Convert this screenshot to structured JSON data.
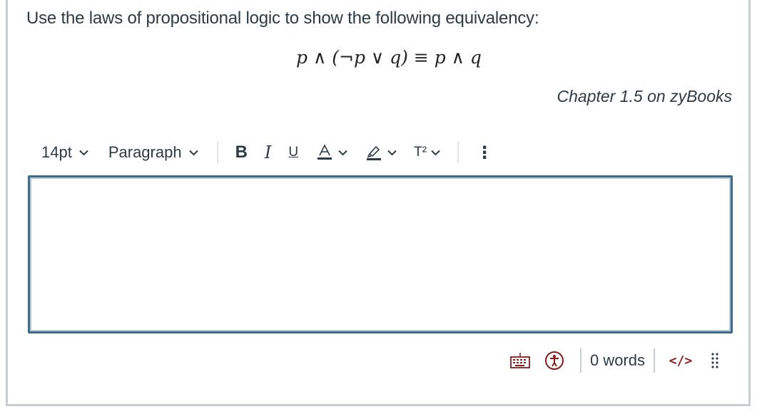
{
  "question": {
    "prompt": "Use the laws of propositional logic to show the following equivalency:",
    "formula": "p ∧ (¬p ∨ q) ≡ p ∧ q",
    "source": "Chapter 1.5 on zyBooks"
  },
  "toolbar": {
    "font_size": "14pt",
    "block_format": "Paragraph",
    "bold_label": "B",
    "italic_label": "I",
    "underline_label": "U",
    "text_color_label": "A",
    "superscript_label": "T²",
    "more_label": "⋮",
    "icons": [
      "chevron-down-icon",
      "text-color-icon",
      "highlight-icon",
      "superscript-icon",
      "more-vertical-icon"
    ]
  },
  "editor": {
    "content": ""
  },
  "statusbar": {
    "icons": [
      "keyboard-icon",
      "accessibility-icon",
      "html-code-icon",
      "drag-handle-icon"
    ],
    "word_count": "0 words",
    "html_label": "</>"
  },
  "colors": {
    "text": "#2d3b45",
    "editor_border": "#3d6b8a",
    "accent_dark_red": "#8b1a1a",
    "card_border": "#c7cdd1"
  }
}
